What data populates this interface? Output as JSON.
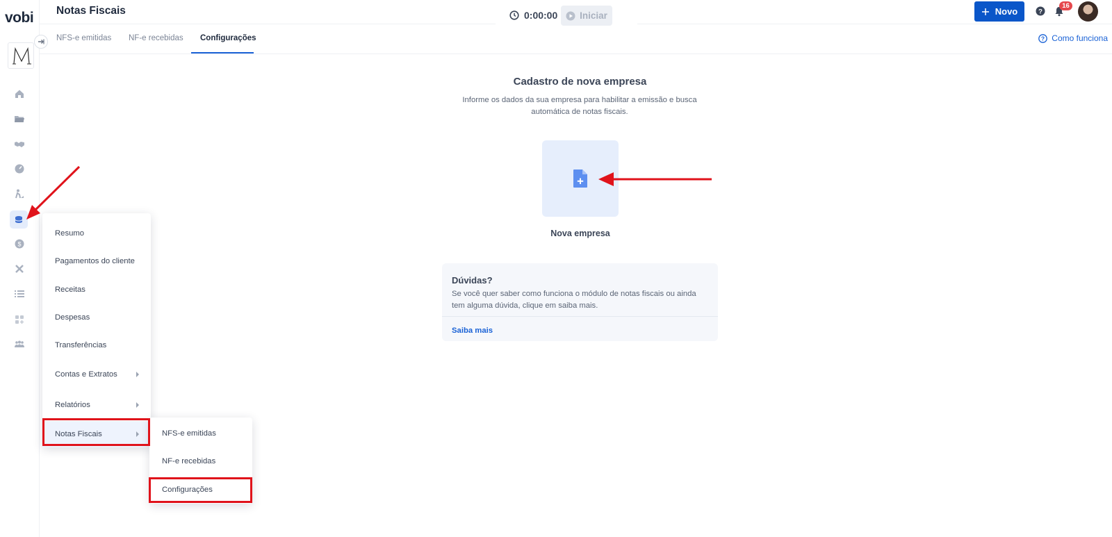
{
  "app": {
    "brand": "vobi",
    "page_title": "Notas Fiscais"
  },
  "timer": {
    "time": "0:00:00",
    "start_label": "Iniciar"
  },
  "header": {
    "new_label": "Novo",
    "notifications_count": "16"
  },
  "tabs": [
    {
      "label": "NFS-e emitidas",
      "active": false
    },
    {
      "label": "NF-e recebidas",
      "active": false
    },
    {
      "label": "Configurações",
      "active": true
    }
  ],
  "how_it_works": "Como funciona",
  "main": {
    "title": "Cadastro de nova empresa",
    "description": "Informe os dados da sua empresa para habilitar a emissão e busca automática de notas fiscais.",
    "new_company_label": "Nova empresa"
  },
  "help_card": {
    "title": "Dúvidas?",
    "text": "Se você quer saber como funciona o módulo de notas fiscais ou ainda tem alguma dúvida, clique em saiba mais.",
    "link": "Saiba mais"
  },
  "sidebar_icons": [
    "home-icon",
    "folder-icon",
    "handshake-icon",
    "gauge-icon",
    "worker-icon",
    "finance-icon",
    "dollar-icon",
    "tools-icon",
    "list-icon",
    "apps-icon",
    "team-icon"
  ],
  "finance_menu": {
    "items": [
      {
        "label": "Resumo",
        "has_submenu": false
      },
      {
        "label": "Pagamentos do cliente",
        "has_submenu": false
      },
      {
        "label": "Receitas",
        "has_submenu": false
      },
      {
        "label": "Despesas",
        "has_submenu": false
      },
      {
        "label": "Transferências",
        "has_submenu": false
      },
      {
        "label": "Contas e Extratos",
        "has_submenu": true
      },
      {
        "label": "Relatórios",
        "has_submenu": true
      },
      {
        "label": "Notas Fiscais",
        "has_submenu": true
      }
    ]
  },
  "notas_submenu": {
    "items": [
      {
        "label": "NFS-e emitidas"
      },
      {
        "label": "NF-e recebidas"
      },
      {
        "label": "Configurações"
      }
    ]
  },
  "colors": {
    "primary": "#0a56c9",
    "link": "#1a62d6",
    "highlight": "#e0131b",
    "badge": "#e5484d"
  }
}
